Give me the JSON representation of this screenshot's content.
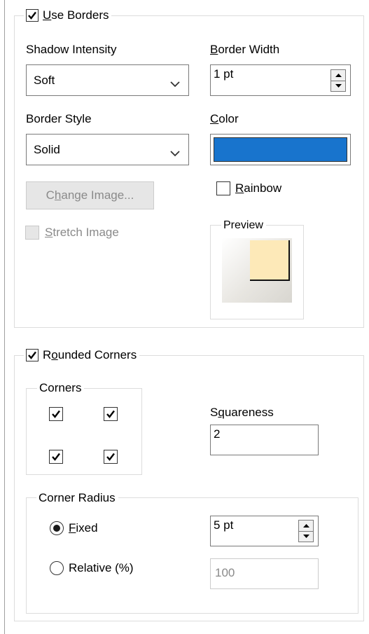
{
  "borders": {
    "use_borders_label_u": "U",
    "use_borders_label_rest": "se Borders",
    "use_borders_checked": true,
    "shadow_intensity_label": "Shadow Intensity",
    "shadow_intensity_value": "Soft",
    "border_width_label_u": "B",
    "border_width_label_rest": "order Width",
    "border_width_value": "1 pt",
    "border_style_label": "Border Style",
    "border_style_value": "Solid",
    "color_label_u": "C",
    "color_label_rest": "olor",
    "color_value": "#1874cd",
    "change_image_pre": "C",
    "change_image_u": "h",
    "change_image_rest": "ange Image...",
    "rainbow_u": "R",
    "rainbow_rest": "ainbow",
    "rainbow_checked": false,
    "stretch_u": "S",
    "stretch_rest": "tretch Image",
    "stretch_checked": false,
    "preview_label": "Preview",
    "preview_fill": "#fde9b8"
  },
  "rounded": {
    "label_pre": "R",
    "label_u": "o",
    "label_rest": "unded Corners",
    "checked": true,
    "corners_label": "Corners",
    "corners": [
      true,
      true,
      true,
      true
    ],
    "squareness_pre": "S",
    "squareness_u": "q",
    "squareness_rest": "uareness",
    "squareness_value": "2",
    "corner_radius_label": "Corner Radius",
    "fixed_u": "F",
    "fixed_rest": "ixed",
    "fixed_selected": true,
    "fixed_value": "5 pt",
    "relative_label": "Relative (%)",
    "relative_selected": false,
    "relative_value": "100"
  }
}
